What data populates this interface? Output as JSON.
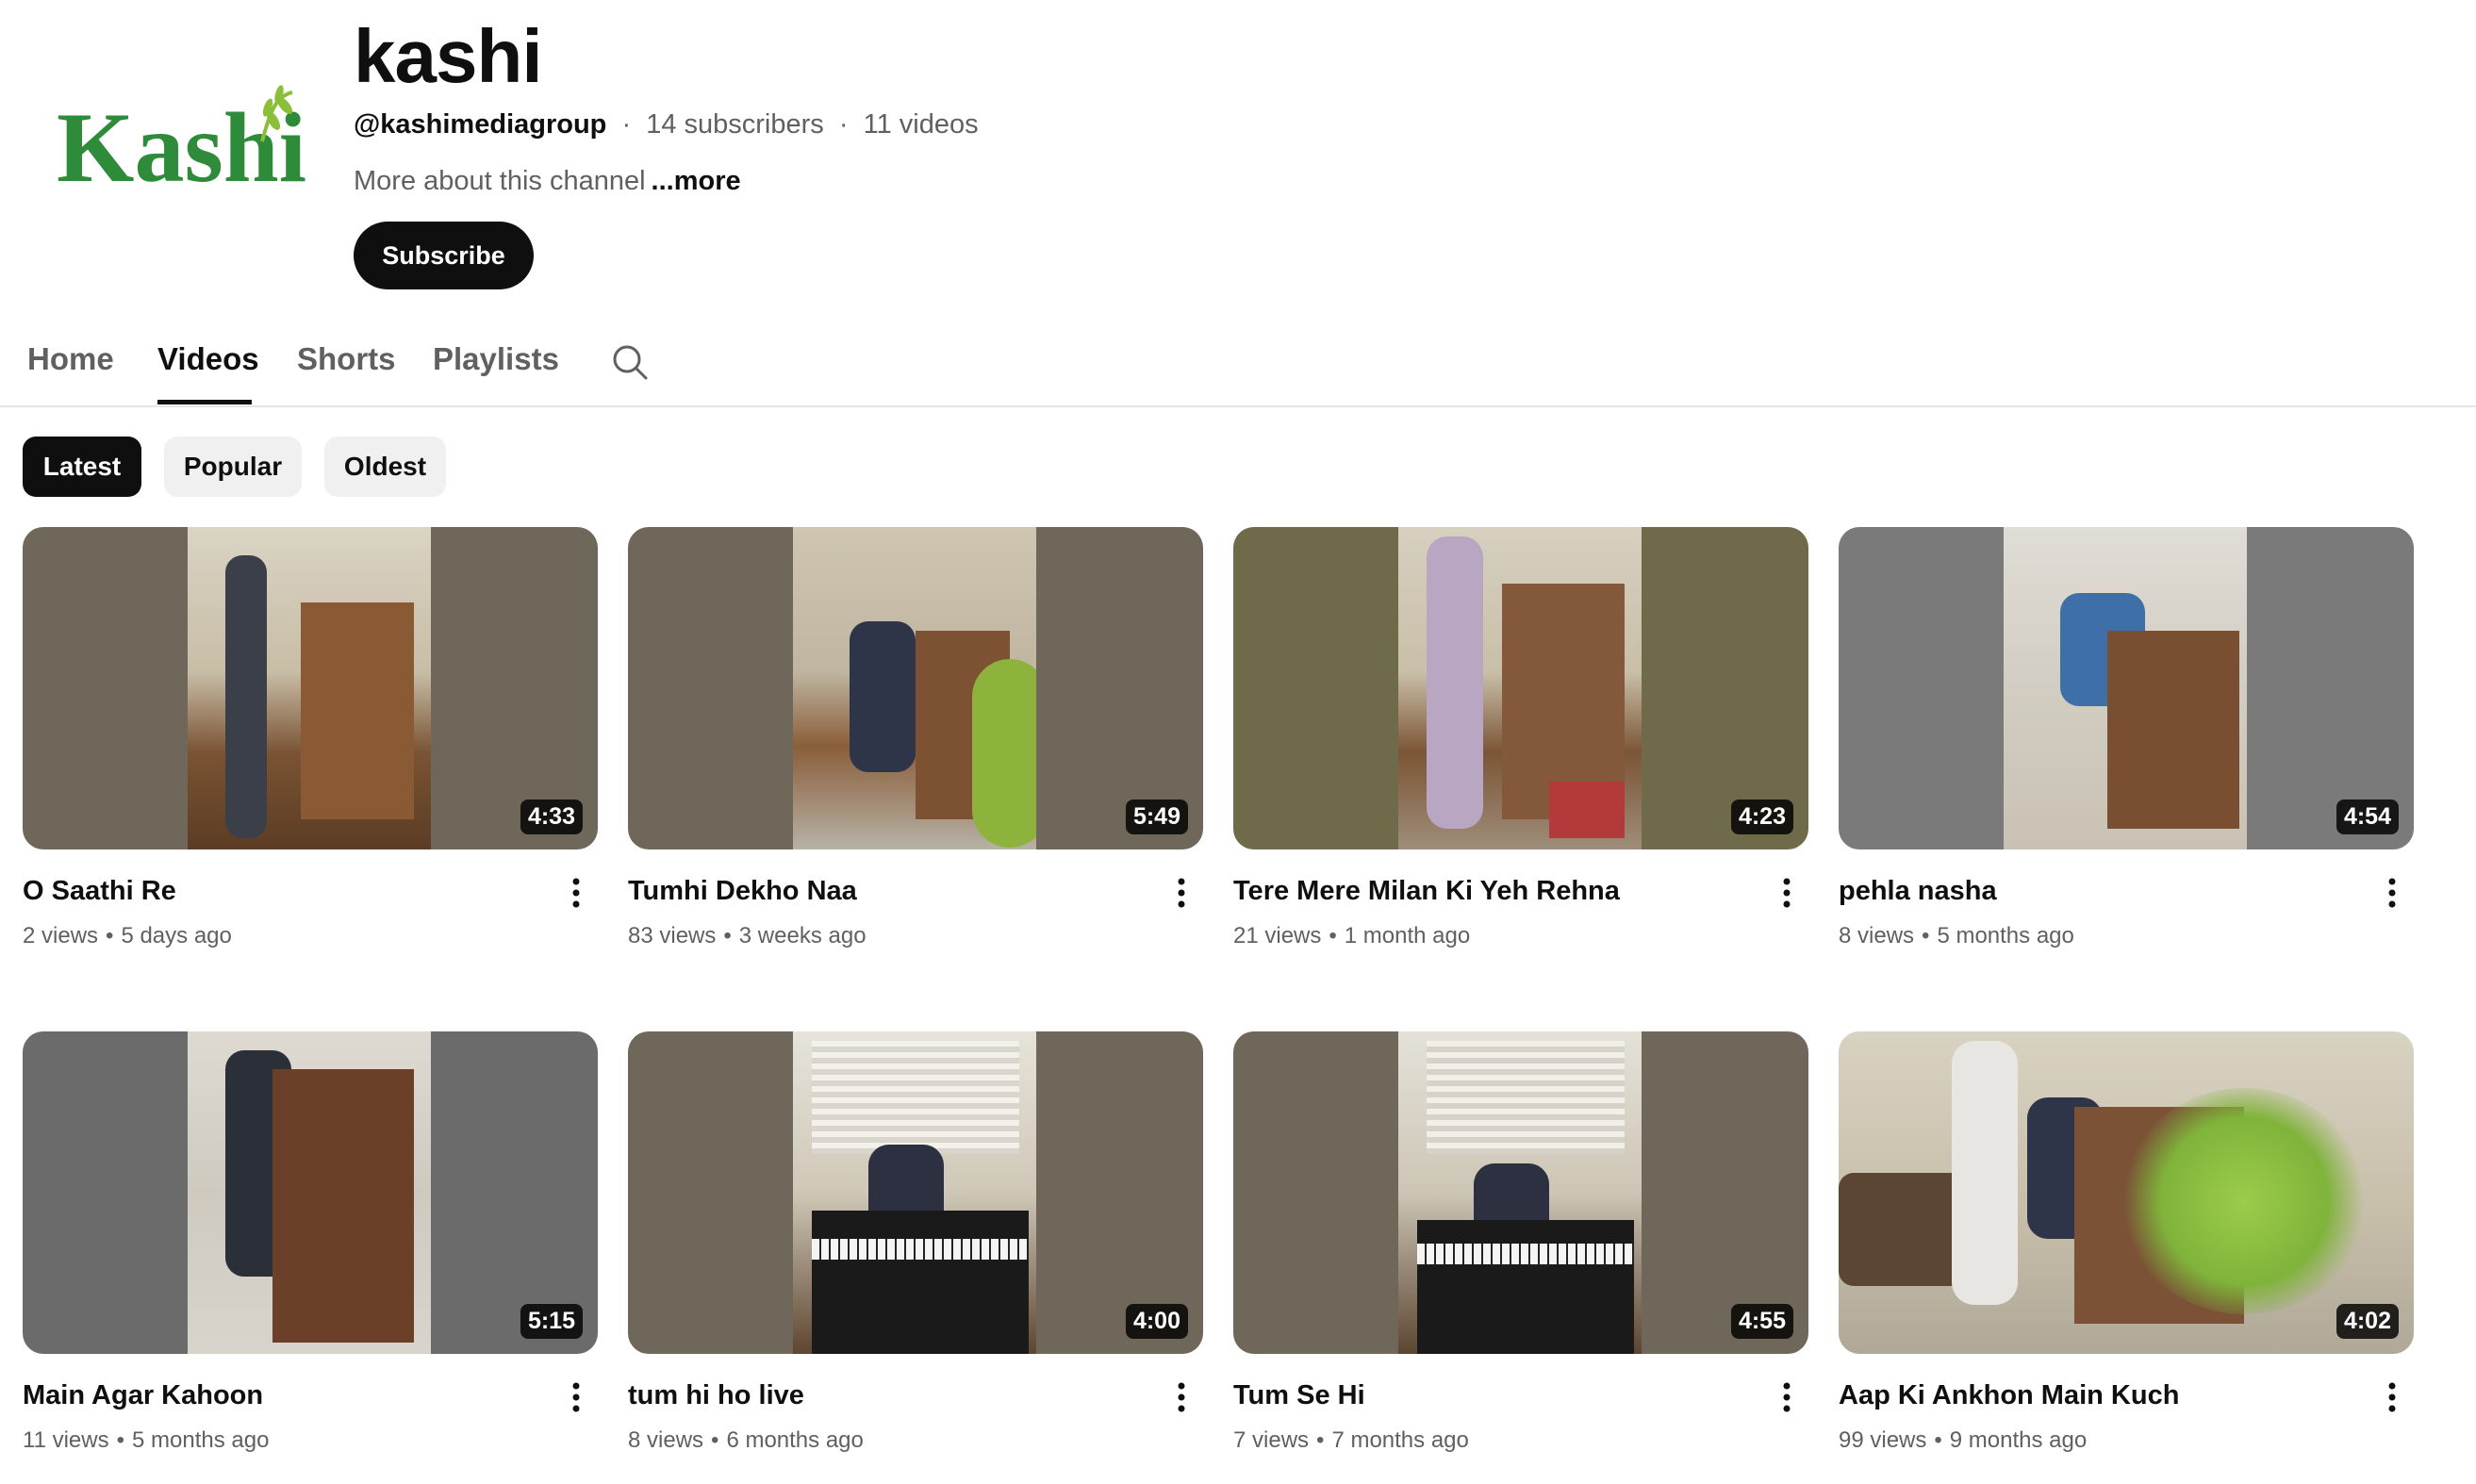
{
  "channel": {
    "logo_text": "Kashi",
    "name": "kashi",
    "handle": "@kashimediagroup",
    "subscribers": "14 subscribers",
    "videos_count": "11 videos",
    "separator": "·",
    "about": "More about this channel",
    "more": "...more",
    "subscribe_label": "Subscribe"
  },
  "tabs": [
    {
      "label": "Home"
    },
    {
      "label": "Videos"
    },
    {
      "label": "Shorts"
    },
    {
      "label": "Playlists"
    }
  ],
  "active_tab": "Videos",
  "search_icon": "search-icon",
  "filters": [
    {
      "label": "Latest"
    },
    {
      "label": "Popular"
    },
    {
      "label": "Oldest"
    }
  ],
  "active_filter": "Latest",
  "stat_separator": "•",
  "videos": [
    {
      "title": "O Saathi Re",
      "duration": "4:33",
      "views": "2 views",
      "age": "5 days ago"
    },
    {
      "title": "Tumhi Dekho Naa",
      "duration": "5:49",
      "views": "83 views",
      "age": "3 weeks ago"
    },
    {
      "title": "Tere Mere Milan Ki Yeh Rehna",
      "duration": "4:23",
      "views": "21 views",
      "age": "1 month ago"
    },
    {
      "title": "pehla nasha",
      "duration": "4:54",
      "views": "8 views",
      "age": "5 months ago"
    },
    {
      "title": "Main Agar Kahoon",
      "duration": "5:15",
      "views": "11 views",
      "age": "5 months ago"
    },
    {
      "title": "tum hi ho live",
      "duration": "4:00",
      "views": "8 views",
      "age": "6 months ago"
    },
    {
      "title": "Tum Se Hi",
      "duration": "4:55",
      "views": "7 views",
      "age": "7 months ago"
    },
    {
      "title": "Aap Ki Ankhon Main Kuch",
      "duration": "4:02",
      "views": "99 views",
      "age": "9 months ago"
    }
  ],
  "colors": {
    "text_primary": "#0f0f0f",
    "text_secondary": "#606060",
    "chip_bg": "#f0f0f0",
    "logo_green": "#2e8b3a",
    "thumb_sides": "#6f685a"
  }
}
